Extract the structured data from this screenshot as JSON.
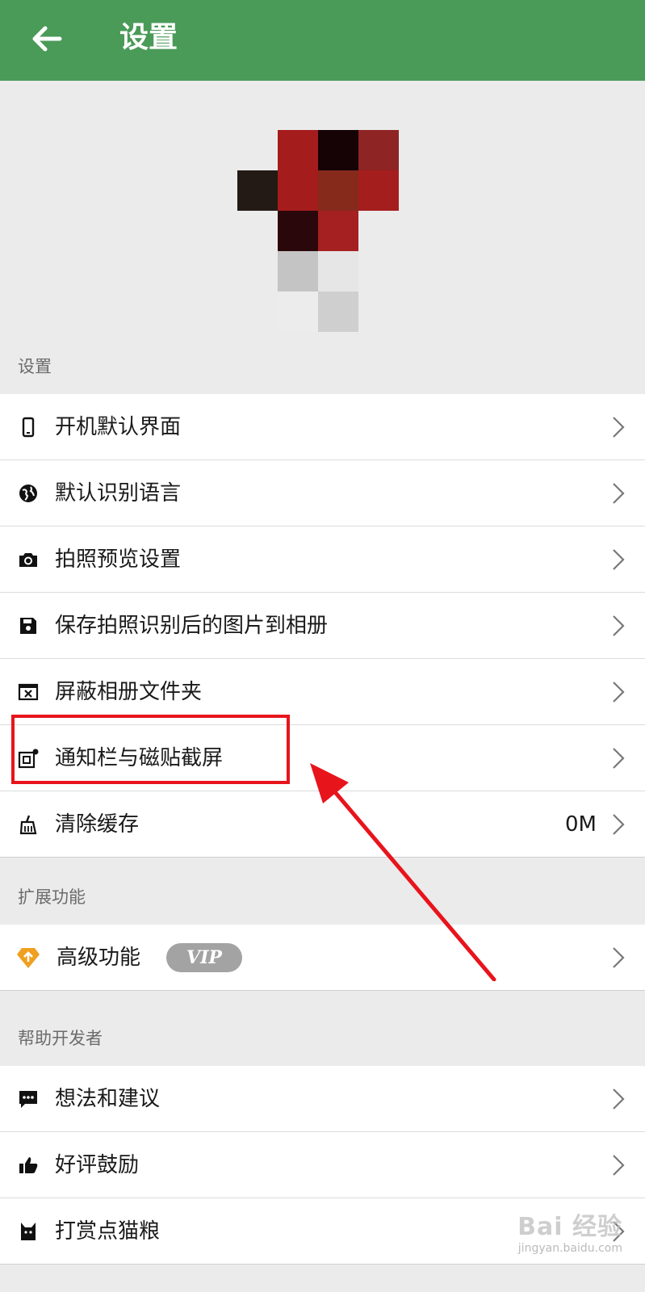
{
  "topbar": {
    "title": "设置",
    "back_icon": "arrow-left-icon"
  },
  "sections": {
    "settings": {
      "header": "设置",
      "items": [
        {
          "label": "开机默认界面",
          "icon": "phone-icon"
        },
        {
          "label": "默认识别语言",
          "icon": "globe-icon"
        },
        {
          "label": "拍照预览设置",
          "icon": "camera-icon"
        },
        {
          "label": "保存拍照识别后的图片到相册",
          "icon": "save-icon"
        },
        {
          "label": "屏蔽相册文件夹",
          "icon": "blocked-window-icon"
        },
        {
          "label": "通知栏与磁贴截屏",
          "icon": "screenshot-icon"
        },
        {
          "label": "清除缓存",
          "icon": "broom-icon",
          "value": "0M"
        }
      ]
    },
    "extensions": {
      "header": "扩展功能",
      "items": [
        {
          "label": "高级功能",
          "icon": "diamond-icon",
          "badge": "VIP"
        }
      ]
    },
    "help": {
      "header": "帮助开发者",
      "items": [
        {
          "label": "想法和建议",
          "icon": "feedback-icon"
        },
        {
          "label": "好评鼓励",
          "icon": "thumbs-up-icon"
        },
        {
          "label": "打赏点猫粮",
          "icon": "cat-icon"
        }
      ]
    }
  },
  "watermark": {
    "main": "Bai 经验",
    "sub": "jingyan.baidu.com"
  },
  "colors": {
    "topbar": "#4a9a58",
    "highlight": "#e8141c",
    "vip_badge": "#a3a3a3"
  }
}
